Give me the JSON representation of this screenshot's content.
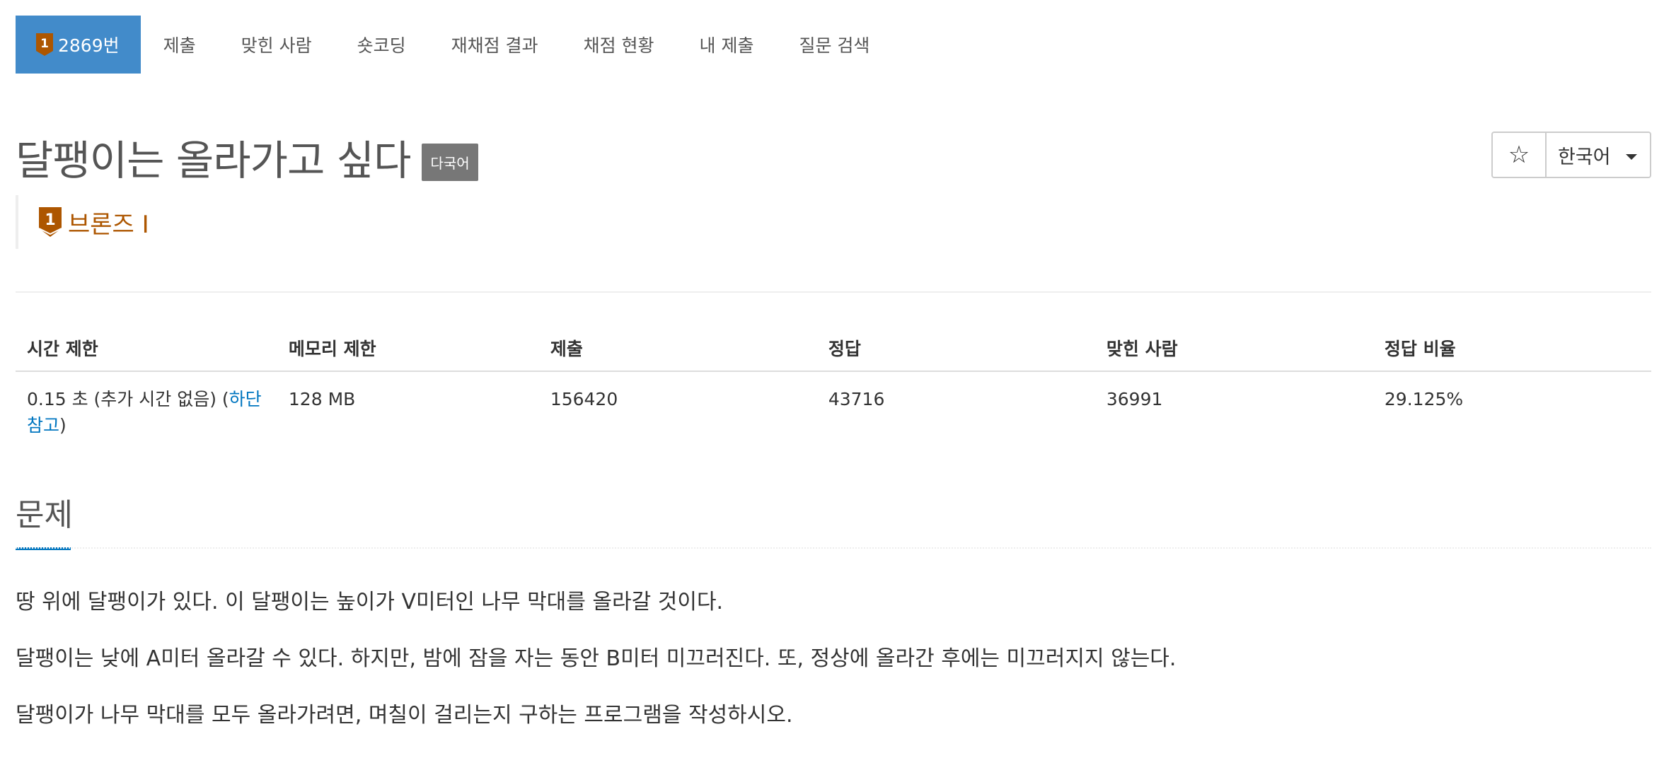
{
  "tabs": [
    {
      "label": "2869번"
    },
    {
      "label": "제출"
    },
    {
      "label": "맞힌 사람"
    },
    {
      "label": "숏코딩"
    },
    {
      "label": "재채점 결과"
    },
    {
      "label": "채점 현황"
    },
    {
      "label": "내 제출"
    },
    {
      "label": "질문 검색"
    }
  ],
  "problem": {
    "title": "달팽이는 올라가고 싶다",
    "multilang_label": "다국어",
    "tier": "브론즈 I",
    "tier_icon": "bronze-1-icon",
    "tier_color": "#ad5600"
  },
  "controls": {
    "star_icon": "☆",
    "language": "한국어"
  },
  "info": {
    "headers": [
      "시간 제한",
      "메모리 제한",
      "제출",
      "정답",
      "맞힌 사람",
      "정답 비율"
    ],
    "time_limit_prefix": "0.15 초 (추가 시간 없음) (",
    "time_limit_link": "하단 참고",
    "time_limit_suffix": ")",
    "memory_limit": "128 MB",
    "submissions": "156420",
    "accepted": "43716",
    "solvers": "36991",
    "ratio": "29.125%"
  },
  "section": {
    "title": "문제",
    "paragraphs": [
      "땅 위에 달팽이가 있다. 이 달팽이는 높이가 V미터인 나무 막대를 올라갈 것이다.",
      "달팽이는 낮에 A미터 올라갈 수 있다. 하지만, 밤에 잠을 자는 동안 B미터 미끄러진다. 또, 정상에 올라간 후에는 미끄러지지 않는다.",
      "달팽이가 나무 막대를 모두 올라가려면, 며칠이 걸리는지 구하는 프로그램을 작성하시오."
    ]
  },
  "colors": {
    "active_tab": "#428bca",
    "link": "#0076c0",
    "bronze": "#ad5600"
  }
}
